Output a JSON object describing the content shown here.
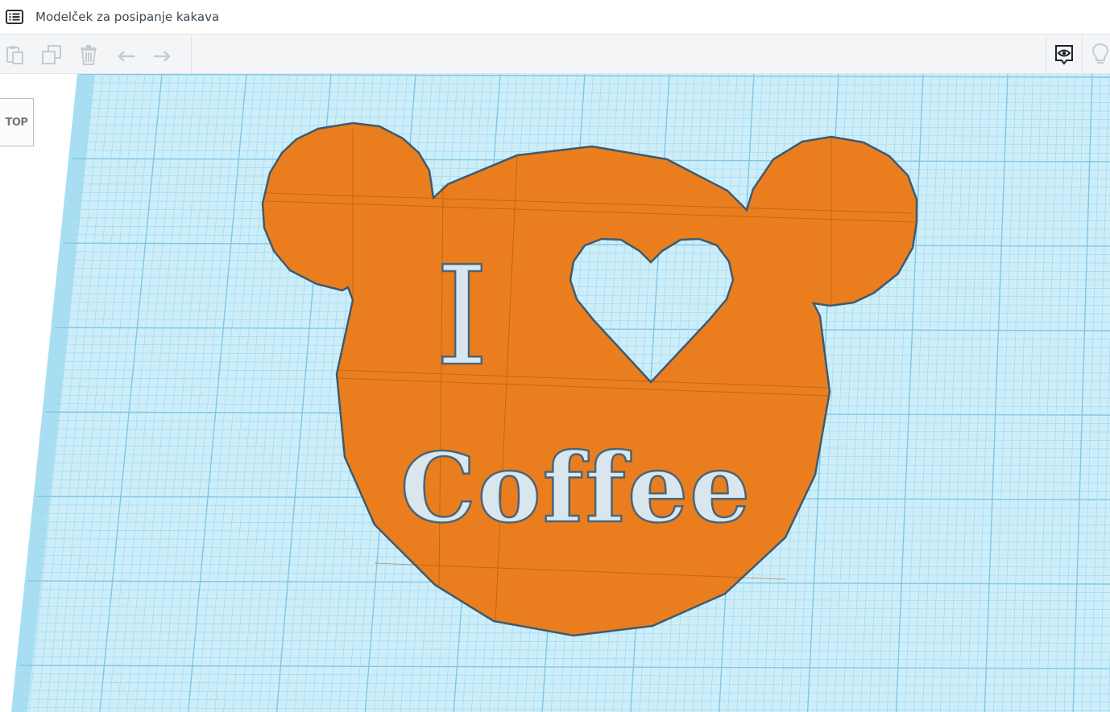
{
  "app": {
    "title": "Modelček za posipanje kakava",
    "menu_icon": "list-icon"
  },
  "toolbar": {
    "left_icons": [
      "paste-icon",
      "duplicate-icon",
      "delete-icon",
      "undo-icon",
      "redo-icon"
    ],
    "right_icons": [
      "notes-visibility-icon",
      "lightbulb-icon"
    ]
  },
  "viewcube": {
    "face_label": "TOP"
  },
  "model": {
    "shape": "bear-head",
    "color": "#ea7e1e",
    "outline_color": "#3e5a70",
    "text_line1": "I",
    "heart_icon": "heart-icon",
    "text_line2": "Coffee"
  },
  "colors": {
    "grid_bg": "#cdeef9",
    "grid_minor": "#9fd9ee",
    "grid_major": "#7fc7e4",
    "toolbar_bg": "#f3f5f7"
  }
}
